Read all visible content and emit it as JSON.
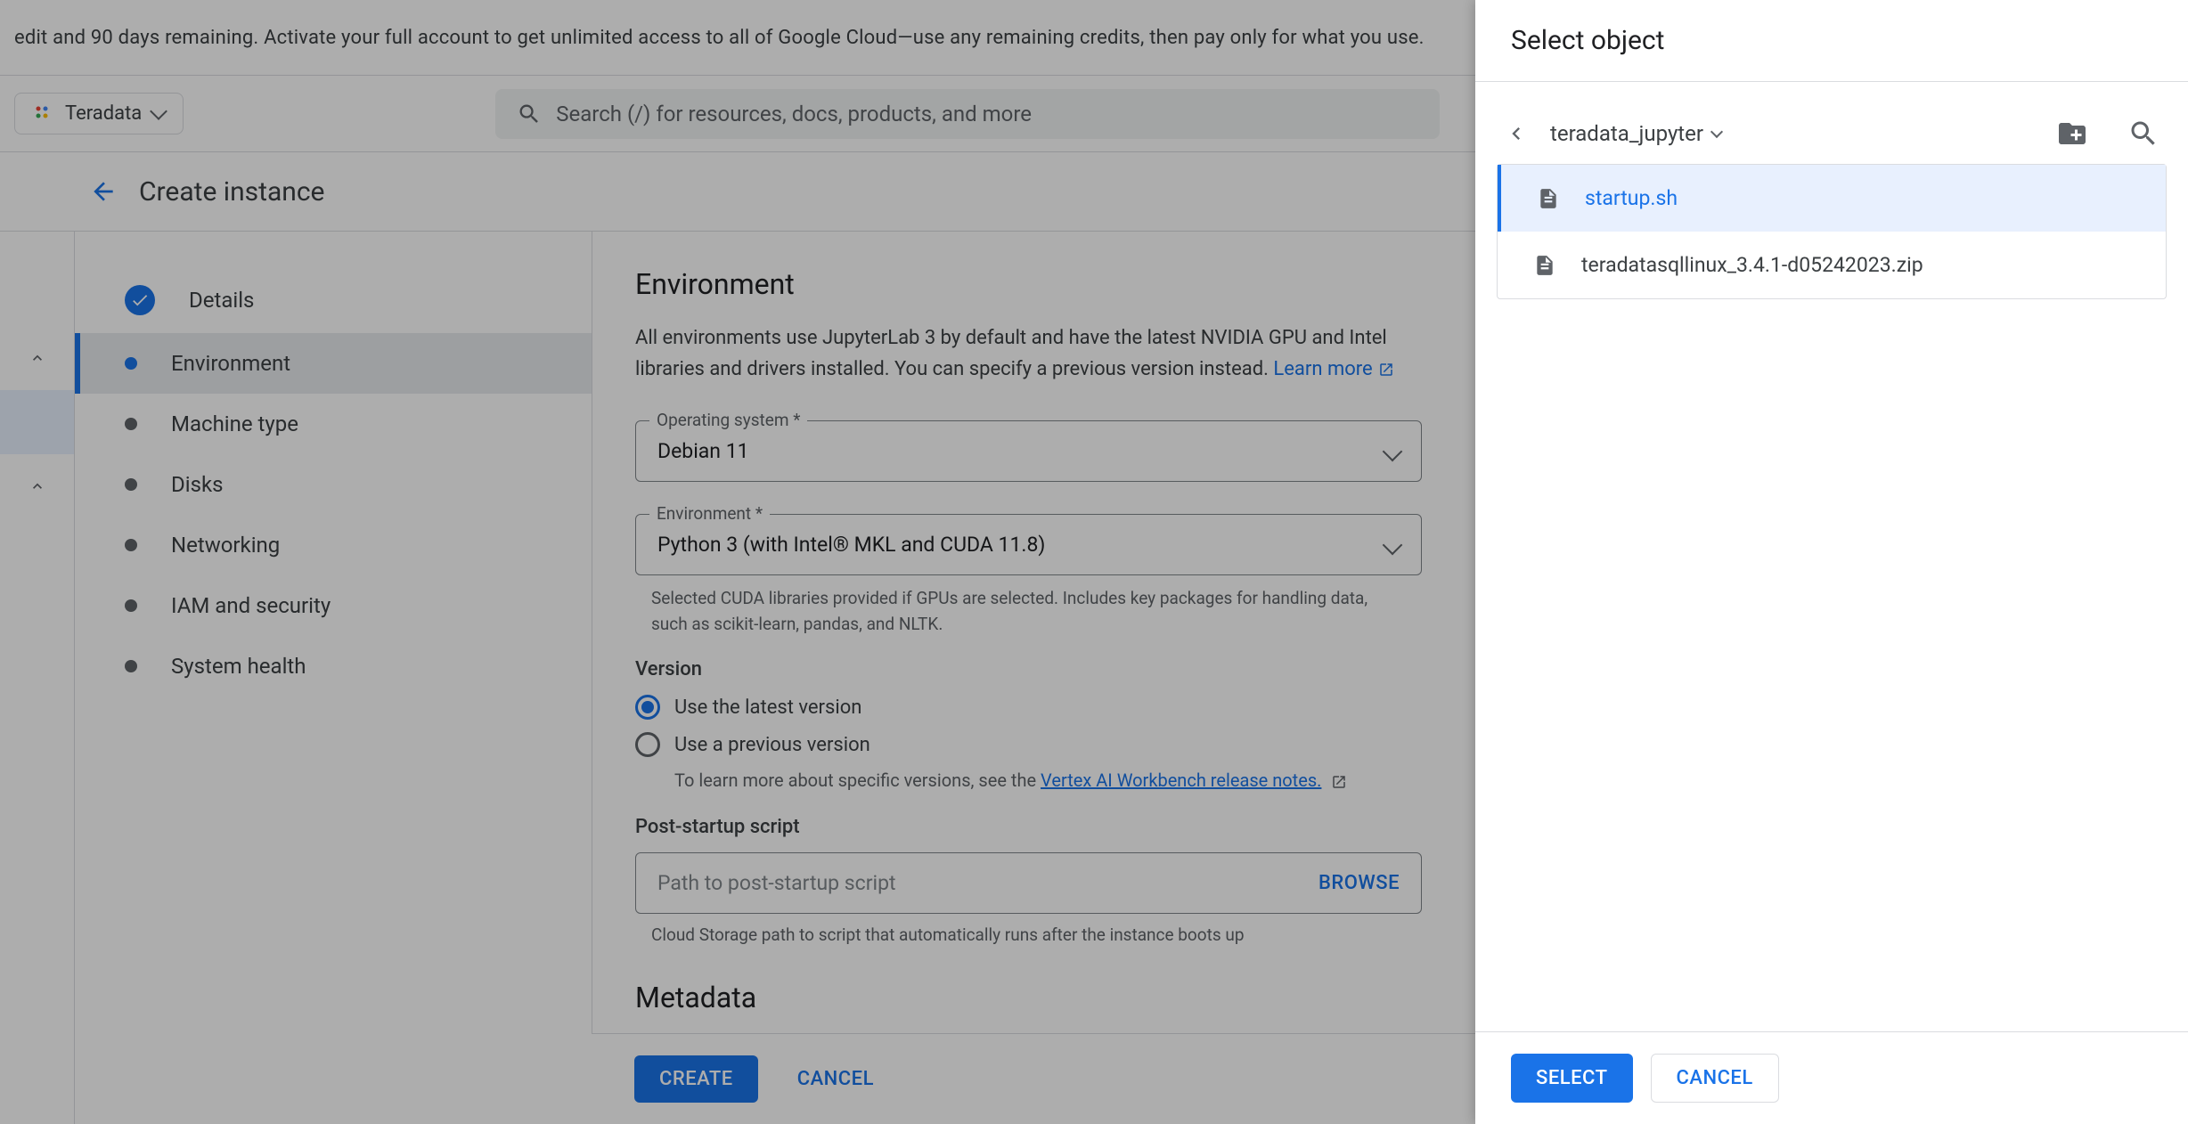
{
  "banner": "edit and 90 days remaining. Activate your full account to get unlimited access to all of Google Cloud—use any remaining credits, then pay only for what you use.",
  "project_name": "Teradata",
  "search_placeholder": "Search (/) for resources, docs, products, and more",
  "page_title": "Create instance",
  "sidebar": {
    "items": [
      {
        "label": "Details"
      },
      {
        "label": "Environment"
      },
      {
        "label": "Machine type"
      },
      {
        "label": "Disks"
      },
      {
        "label": "Networking"
      },
      {
        "label": "IAM and security"
      },
      {
        "label": "System health"
      }
    ]
  },
  "env": {
    "title": "Environment",
    "desc_a": "All environments use JupyterLab 3 by default and have the latest NVIDIA GPU and Intel libraries and drivers installed. You can specify a previous version instead. ",
    "learn_more": "Learn more",
    "os_label": "Operating system *",
    "os_value": "Debian 11",
    "env_label": "Environment *",
    "env_value": "Python 3 (with Intel® MKL and CUDA 11.8)",
    "env_help": "Selected CUDA libraries provided if GPUs are selected. Includes key packages for handling data, such as scikit-learn, pandas, and NLTK.",
    "version_head": "Version",
    "version_opt1": "Use the latest version",
    "version_opt2": "Use a previous version",
    "version_help_a": "To learn more about specific versions, see the ",
    "version_help_link": "Vertex AI Workbench release notes.",
    "script_head": "Post-startup script",
    "script_placeholder": "Path to post-startup script",
    "browse": "BROWSE",
    "script_help": "Cloud Storage path to script that automatically runs after the instance boots up",
    "metadata_head": "Metadata"
  },
  "footer": {
    "create": "CREATE",
    "cancel": "CANCEL"
  },
  "drawer": {
    "title": "Select object",
    "location": "teradata_jupyter",
    "files": [
      {
        "name": "startup.sh"
      },
      {
        "name": "teradatasqllinux_3.4.1-d05242023.zip"
      }
    ],
    "select": "SELECT",
    "cancel": "CANCEL"
  }
}
